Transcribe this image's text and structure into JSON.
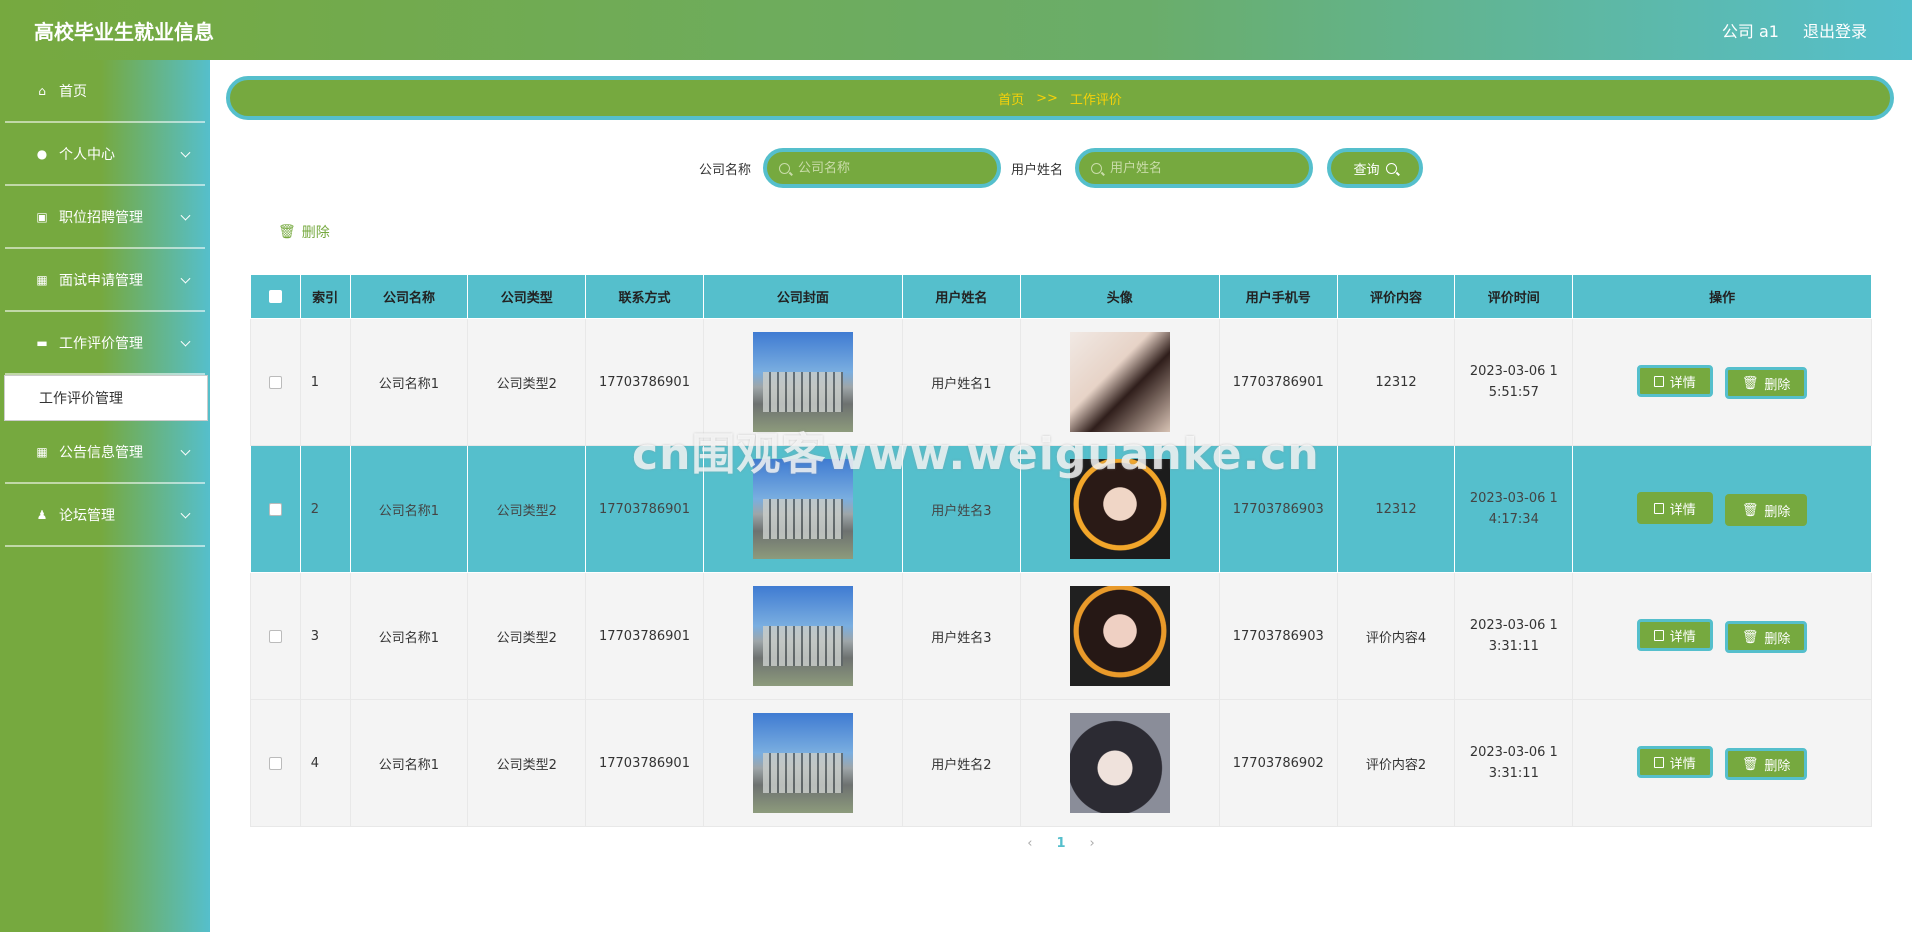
{
  "header": {
    "title": "高校毕业生就业信息",
    "user": "公司 a1",
    "logout": "退出登录"
  },
  "sidebar": {
    "items": [
      {
        "label": "首页",
        "icon": "home-icon"
      },
      {
        "label": "个人中心",
        "icon": "user-icon"
      },
      {
        "label": "职位招聘管理",
        "icon": "chart-icon"
      },
      {
        "label": "面试申请管理",
        "icon": "grid-icon"
      },
      {
        "label": "工作评价管理",
        "icon": "chat-icon"
      },
      {
        "label": "公告信息管理",
        "icon": "grid-icon"
      },
      {
        "label": "论坛管理",
        "icon": "person-icon"
      }
    ],
    "submenu_active": "工作评价管理"
  },
  "breadcrumb": {
    "home": "首页",
    "sep": ">>",
    "current": "工作评价"
  },
  "search": {
    "company_label": "公司名称",
    "company_placeholder": "公司名称",
    "user_label": "用户姓名",
    "user_placeholder": "用户姓名",
    "query_label": "查询"
  },
  "toolbar": {
    "delete_label": "删除"
  },
  "table": {
    "headers": [
      "索引",
      "公司名称",
      "公司类型",
      "联系方式",
      "公司封面",
      "用户姓名",
      "头像",
      "用户手机号",
      "评价内容",
      "评价时间",
      "操作"
    ],
    "detail_label": "详情",
    "delete_label": "删除",
    "rows": [
      {
        "index": "1",
        "company": "公司名称1",
        "type": "公司类型2",
        "contact": "17703786901",
        "user": "用户姓名1",
        "phone": "17703786901",
        "content": "12312",
        "time1": "2023-03-06 1",
        "time2": "5:51:57"
      },
      {
        "index": "2",
        "company": "公司名称1",
        "type": "公司类型2",
        "contact": "17703786901",
        "user": "用户姓名3",
        "phone": "17703786903",
        "content": "12312",
        "time1": "2023-03-06 1",
        "time2": "4:17:34"
      },
      {
        "index": "3",
        "company": "公司名称1",
        "type": "公司类型2",
        "contact": "17703786901",
        "user": "用户姓名3",
        "phone": "17703786903",
        "content": "评价内容4",
        "time1": "2023-03-06 1",
        "time2": "3:31:11"
      },
      {
        "index": "4",
        "company": "公司名称1",
        "type": "公司类型2",
        "contact": "17703786901",
        "user": "用户姓名2",
        "phone": "17703786902",
        "content": "评价内容2",
        "time1": "2023-03-06 1",
        "time2": "3:31:11"
      }
    ]
  },
  "pager": {
    "prev": "‹",
    "page": "1",
    "next": "›"
  },
  "watermark": "cn围观客www.weiguanke.cn",
  "colors": {
    "primary": "#76a93f",
    "accent": "#55bfcc",
    "breadcrumb_text": "#f5d10a"
  }
}
